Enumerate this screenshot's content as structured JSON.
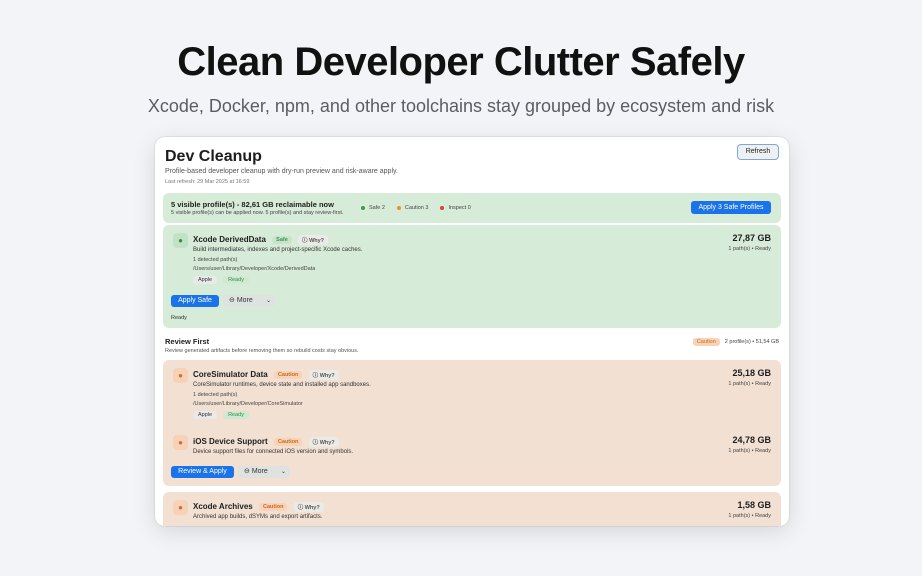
{
  "hero": {
    "title": "Clean Developer Clutter Safely",
    "subtitle": "Xcode, Docker, npm, and other toolchains stay grouped by ecosystem and risk"
  },
  "app": {
    "title": "Dev Cleanup",
    "subtitle": "Profile-based developer cleanup with dry-run preview and risk-aware apply.",
    "last_refresh": "Last refresh: 29 Mar 2025 at 16:59",
    "refresh_label": "Refresh"
  },
  "summary": {
    "title": "5 visible profile(s) - 82,61 GB reclaimable now",
    "description": "5 visible profile(s) can be applied now. 5 profile(s) and stay review-first.",
    "legend": [
      {
        "label": "Safe 2",
        "color": "#3d9a4a"
      },
      {
        "label": "Caution 3",
        "color": "#e8913c"
      },
      {
        "label": "Inspect 0",
        "color": "#d9433a"
      }
    ],
    "apply_label": "Apply 3 Safe Profiles"
  },
  "safe_group": {
    "item": {
      "icon": "safe-profile-icon",
      "name": "Xcode DerivedData",
      "badge": "Safe",
      "why": "Why?",
      "description": "Build intermediates, indexes and project-specific Xcode caches.",
      "paths": "1 detected path(s)",
      "location": "/Users/user/Library/Developer/Xcode/DerivedData",
      "tags": [
        "Apple",
        "Ready"
      ],
      "size": "27,87 GB",
      "status": "1 path(s) • Ready"
    },
    "apply_label": "Apply Safe",
    "more_label": "More",
    "footer": "Ready"
  },
  "review": {
    "title": "Review First",
    "description": "Review generated artifacts before removing them so rebuild costs stay obvious.",
    "badge": "Caution",
    "summary": "2 profile(s) • 51,54 GB",
    "items": [
      {
        "name": "CoreSimulator Data",
        "badge": "Caution",
        "why": "Why?",
        "description": "CoreSimulator runtimes, device state and installed app sandboxes.",
        "paths": "1 detected path(s)",
        "location": "/Users/user/Library/Developer/CoreSimulator",
        "tags": [
          "Apple",
          "Ready"
        ],
        "size": "25,18 GB",
        "status": "1 path(s) • Ready"
      },
      {
        "name": "iOS Device Support",
        "badge": "Caution",
        "why": "Why?",
        "description": "Device support files for connected iOS version and symbols.",
        "size": "24,78 GB",
        "status": "1 path(s) • Ready"
      }
    ],
    "apply_label": "Review & Apply",
    "more_label": "More"
  },
  "archives": {
    "name": "Xcode Archives",
    "badge": "Caution",
    "why": "Why?",
    "description": "Archived app builds, dSYMs and export artifacts.",
    "size": "1,58 GB",
    "status": "1 path(s) • Ready"
  }
}
